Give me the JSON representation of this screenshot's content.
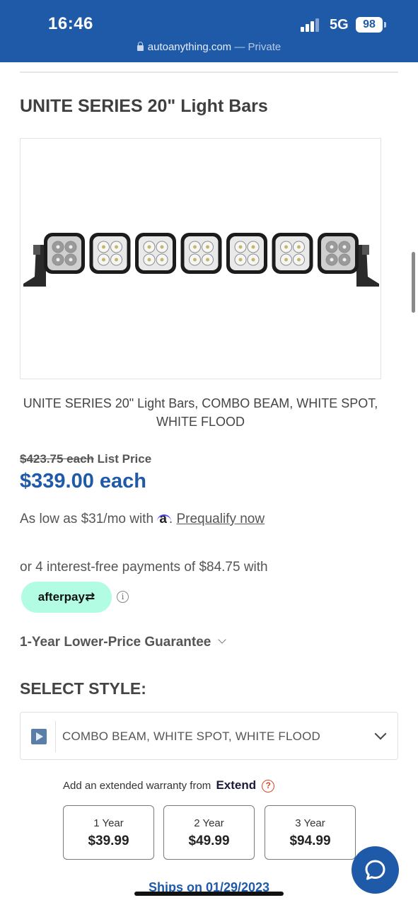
{
  "status_bar": {
    "time": "16:46",
    "network": "5G",
    "battery": "98",
    "url": "autoanything.com",
    "url_suffix": "— Private"
  },
  "product": {
    "title": "UNITE SERIES 20\" Light Bars",
    "caption": "UNITE SERIES 20\" Light Bars, COMBO BEAM, WHITE SPOT, WHITE FLOOD"
  },
  "pricing": {
    "list_price_value": "$423.75 each",
    "list_price_label": "List Price",
    "sale_price": "$339.00 each"
  },
  "financing": {
    "affirm_text": "As low as $31/mo with",
    "affirm_logo": "a",
    "affirm_dot": ".",
    "prequalify_link": "Prequalify now",
    "afterpay_text": "or 4 interest-free payments of $84.75 with",
    "afterpay_logo": "afterpay⇄",
    "info_icon": "i"
  },
  "guarantee": {
    "label": "1-Year Lower-Price Guarantee"
  },
  "style_select": {
    "label": "SELECT STYLE:",
    "value": "COMBO BEAM, WHITE SPOT, WHITE FLOOD"
  },
  "warranty": {
    "text": "Add an extended warranty from",
    "brand": "Extend",
    "help_icon": "?",
    "plans": [
      {
        "term": "1 Year",
        "price": "$39.99"
      },
      {
        "term": "2 Year",
        "price": "$49.99"
      },
      {
        "term": "3 Year",
        "price": "$94.99"
      }
    ]
  },
  "shipping": {
    "ships_text": "Ships on 01/29/2023"
  },
  "colors": {
    "brand_blue": "#1f5aa8",
    "afterpay_mint": "#b2fce4"
  },
  "icons": {
    "lock": "lock-icon",
    "chat": "chat-bubble-icon",
    "chevron": "chevron-down-icon",
    "play": "play-icon"
  }
}
